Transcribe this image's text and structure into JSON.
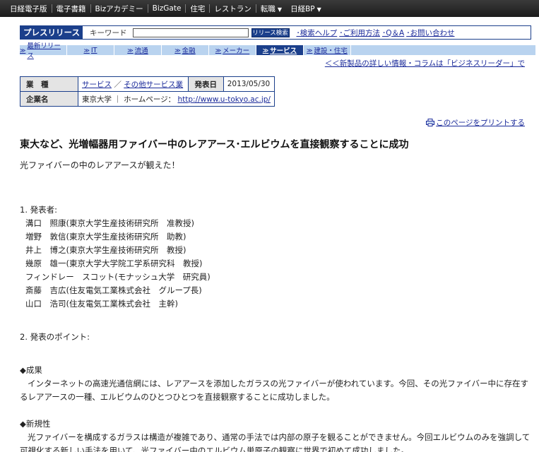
{
  "topnav": {
    "items": [
      "日経電子版",
      "電子書籍",
      "Bizアカデミー",
      "BizGate",
      "住宅",
      "レストラン",
      "転職",
      "日経BP"
    ]
  },
  "search": {
    "label": "プレスリリース",
    "keyword_label": "キーワード",
    "input_value": "",
    "button": "リリース検索",
    "links": [
      "･検索ヘルプ",
      "･ご利用方法",
      "･Q＆A",
      "･お問い合わせ"
    ]
  },
  "tabs": [
    {
      "label": "最新リリース",
      "active": false
    },
    {
      "label": "IT",
      "active": false
    },
    {
      "label": "流通",
      "active": false
    },
    {
      "label": "金融",
      "active": false
    },
    {
      "label": "メーカー",
      "active": false
    },
    {
      "label": "サービス",
      "active": true
    },
    {
      "label": "建設・住宅",
      "active": false
    }
  ],
  "promo_link": "＜＜新製品の詳しい情報・コラムは「ビジネスリーダー」で",
  "info": {
    "industry_label": "業　種",
    "industry_link1": "サービス",
    "industry_sep": "／",
    "industry_link2": "その他サービス業",
    "date_label": "発表日",
    "date": "2013/05/30",
    "company_label": "企業名",
    "company_text": "東京大学 ｜ ホームページ：",
    "company_url": "http://www.u-tokyo.ac.jp/"
  },
  "print_link": "このページをプリントする",
  "article": {
    "title": "東大など、光増幅器用ファイバー中のレアアース･エルビウムを直接観察することに成功",
    "subtitle": "光ファイバーの中のレアアースが観えた！",
    "presenters_heading": "1. 発表者:",
    "presenters": [
      "溝口　照康(東京大学生産技術研究所　准教授)",
      "増野　敦信(東京大学生産技術研究所　助教)",
      "井上　博之(東京大学生産技術研究所　教授)",
      "幾原　雄一(東京大学大学院工学系研究科　教授)",
      "フィンドレー　スコット(モナッシュ大学　研究員)",
      "斎藤　吉広(住友電気工業株式会社　グループ長)",
      "山口　浩司(住友電気工業株式会社　主幹)"
    ],
    "points_heading": "2. 発表のポイント:",
    "result_heading": "◆成果",
    "result_text": "インターネットの高速光通信網には、レアアースを添加したガラスの光ファイバーが使われています。今回、その光ファイバー中に存在するレアアースの一種、エルビウムのひとつひとつを直接観察することに成功しました。",
    "novelty_heading": "◆新規性",
    "novelty_text": "光ファイバーを構成するガラスは構造が複雑であり、通常の手法では内部の原子を観ることができません。今回エルビウムのみを強調して可視化する新しい手法を用いて、光ファイバー中のエルビウム単原子の観察に世界で初めて成功しました。"
  }
}
